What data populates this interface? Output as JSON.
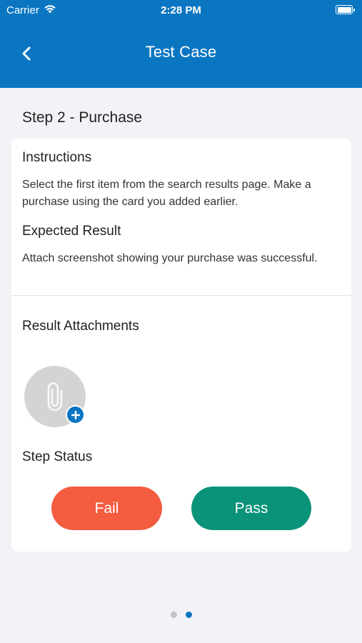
{
  "status_bar": {
    "carrier": "Carrier",
    "time": "2:28 PM",
    "wifi_icon": "wifi-icon",
    "battery_icon": "battery-icon"
  },
  "nav": {
    "title": "Test Case",
    "back_icon": "chevron-left-icon"
  },
  "step": {
    "title": "Step 2 - Purchase"
  },
  "instructions": {
    "label": "Instructions",
    "text": "Select the first item from the search results page. Make a purchase using the card you added earlier."
  },
  "expected": {
    "label": "Expected Result",
    "text": "Attach screenshot showing your purchase was successful."
  },
  "attachments": {
    "label": "Result Attachments",
    "icon": "paperclip-icon",
    "add_icon": "plus-icon"
  },
  "status": {
    "label": "Step Status",
    "fail_label": "Fail",
    "pass_label": "Pass"
  },
  "pagination": {
    "pages": 2,
    "current": 2
  },
  "colors": {
    "brand": "#0a76c2",
    "fail": "#f45c40",
    "pass": "#0a9378",
    "background": "#f1f3f6"
  }
}
